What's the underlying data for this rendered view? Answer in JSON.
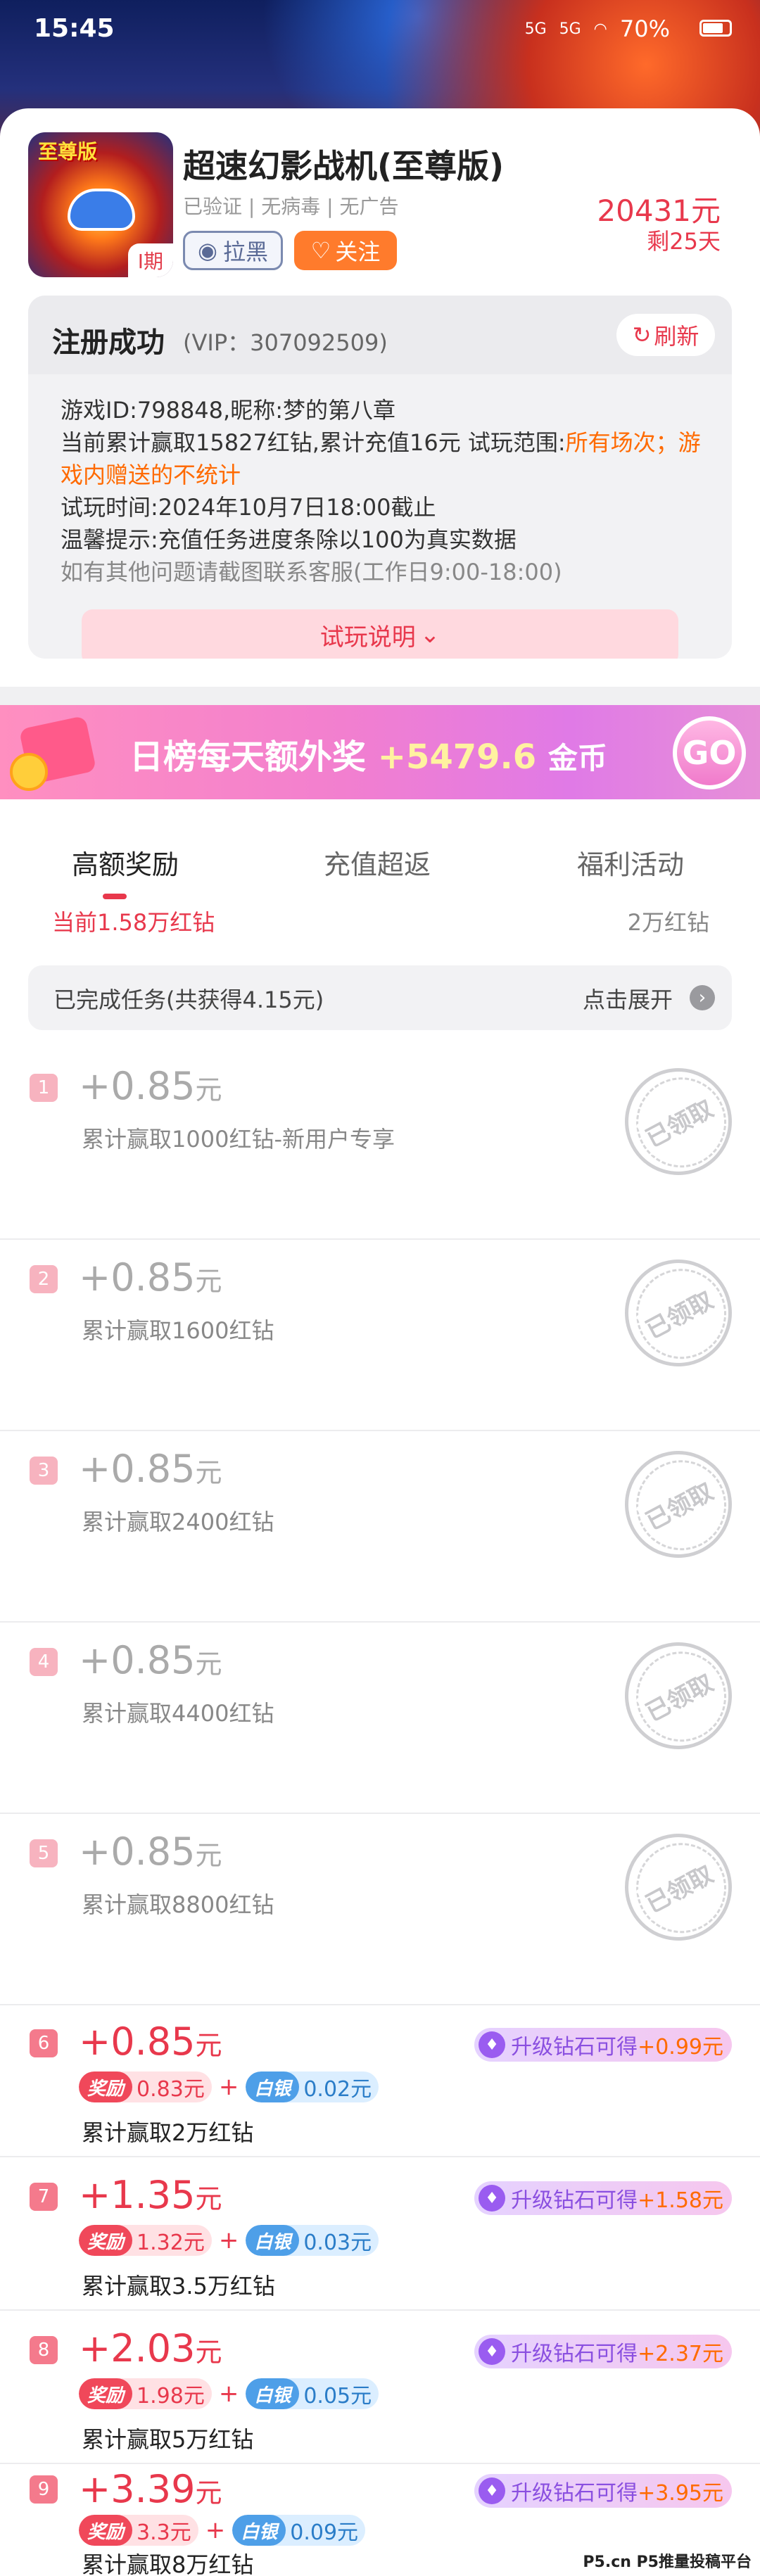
{
  "status_bar": {
    "time": "15:45",
    "signal1": "5G",
    "signal2": "5G",
    "battery": "70%"
  },
  "game": {
    "icon_label": "至尊版",
    "period": "Ⅰ期",
    "title": "超速幻影战机(至尊版)",
    "tags": "已验证 | 无病毒 | 无广告",
    "price": "20431元",
    "remaining": "剩25天",
    "block_label": "拉黑",
    "follow_label": "关注"
  },
  "register": {
    "title": "注册成功",
    "vip": "(VIP：307092509)",
    "refresh_label": "刷新",
    "line1": "游戏ID:798848,昵称:梦的第八章",
    "line2a": "当前累计赢取15827红钻,累计充值16元 试玩范围:",
    "line2b": "所有场次；游戏内赠送的不统计",
    "line3": "试玩时间:2024年10月7日18:00截止",
    "line4": "温馨提示:充值任务进度条除以100为真实数据",
    "line5": "如有其他问题请截图联系客服(工作日9:00-18:00)",
    "trial_label": "试玩说明"
  },
  "promo": {
    "text": "日榜每天额外奖",
    "amount": "+5479.6",
    "unit": "金币",
    "go_label": "GO"
  },
  "tabs": [
    {
      "label": "高额奖励"
    },
    {
      "label": "充值超返"
    },
    {
      "label": "福利活动"
    }
  ],
  "progress_peek": {
    "current": "当前1.58万红钻",
    "target": "2万红钻"
  },
  "completed": {
    "label": "已完成任务(共获得4.15元)",
    "expand": "点击展开"
  },
  "claimed_stamp": "已领取",
  "tasks": [
    {
      "num": "1",
      "amount": "+0.85",
      "unit": "元",
      "desc": "累计赢取1000红钻-新用户专享"
    },
    {
      "num": "2",
      "amount": "+0.85",
      "unit": "元",
      "desc": "累计赢取1600红钻"
    },
    {
      "num": "3",
      "amount": "+0.85",
      "unit": "元",
      "desc": "累计赢取2400红钻"
    },
    {
      "num": "4",
      "amount": "+0.85",
      "unit": "元",
      "desc": "累计赢取4400红钻"
    },
    {
      "num": "5",
      "amount": "+0.85",
      "unit": "元",
      "desc": "累计赢取8800红钻"
    },
    {
      "num": "6",
      "amount": "+0.85",
      "unit": "元",
      "desc": "累计赢取2万红钻",
      "upgrade": "升级钻石可得",
      "bonus": "+0.99元",
      "reward": "0.83元",
      "silver": "0.02元"
    },
    {
      "num": "7",
      "amount": "+1.35",
      "unit": "元",
      "desc": "累计赢取3.5万红钻",
      "upgrade": "升级钻石可得",
      "bonus": "+1.58元",
      "reward": "1.32元",
      "silver": "0.03元"
    },
    {
      "num": "8",
      "amount": "+2.03",
      "unit": "元",
      "desc": "累计赢取5万红钻",
      "upgrade": "升级钻石可得",
      "bonus": "+2.37元",
      "reward": "1.98元",
      "silver": "0.05元"
    },
    {
      "num": "9",
      "amount": "+3.39",
      "unit": "元",
      "desc": "累计赢取8万红钻",
      "upgrade": "升级钻石可得",
      "bonus": "+3.95元",
      "reward": "3.3元",
      "silver": "0.09元"
    }
  ],
  "chip_labels": {
    "reward": "奖励",
    "silver": "白银",
    "plus": "+"
  },
  "watermark": "P5.cn P5推量投稿平台",
  "colors": {
    "accent": "#e8384c",
    "follow": "#ff7b2c",
    "promo": "#f27fcf"
  }
}
